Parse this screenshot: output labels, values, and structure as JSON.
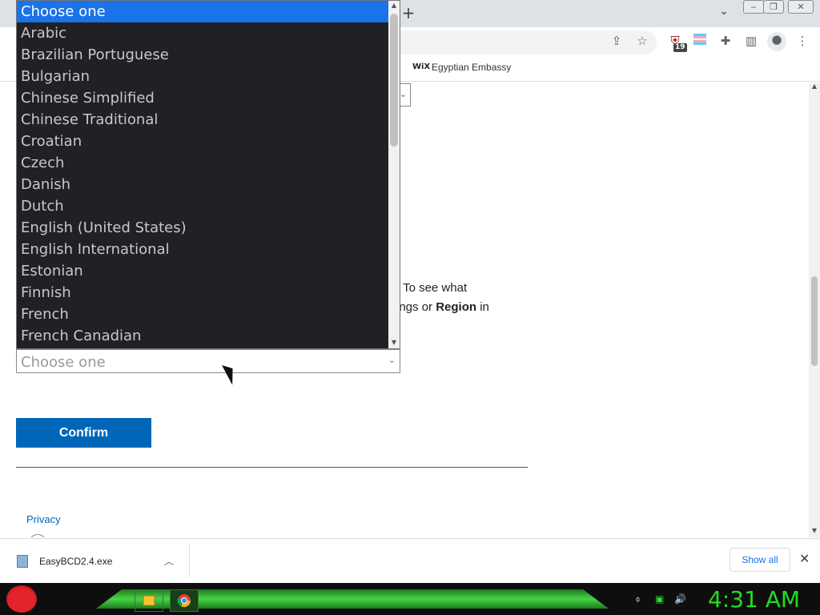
{
  "browser": {
    "new_tab_glyph": "+",
    "tab_search_glyph": "⌄",
    "window_controls": [
      "‒",
      "❐",
      "✕"
    ],
    "toolbar_icons": [
      "share-icon",
      "bookmark-star-icon",
      "extension-shield-icon",
      "extension-flag-icon",
      "extensions-puzzle-icon",
      "side-panel-icon",
      "profile-icon",
      "menu-icon"
    ],
    "extension_badge": "19",
    "bookmark": {
      "favicon_text": "WiX",
      "label": "Egyptian Embassy"
    }
  },
  "page": {
    "partial_line1": ". To see what",
    "partial_line2_pre": "ings or ",
    "partial_line2_bold": "Region",
    "partial_line2_post": " in",
    "select_placeholder": "Choose one",
    "confirm_label": "Confirm",
    "privacy_link": "Privacy"
  },
  "dropdown": {
    "items": [
      "Choose one",
      "Arabic",
      "Brazilian Portuguese",
      "Bulgarian",
      "Chinese Simplified",
      "Chinese Traditional",
      "Croatian",
      "Czech",
      "Danish",
      "Dutch",
      "English (United States)",
      "English International",
      "Estonian",
      "Finnish",
      "French",
      "French Canadian"
    ],
    "selected_index": 0,
    "colors": {
      "background": "#202124",
      "highlight": "#1a73e8",
      "text": "#c8c8c8"
    }
  },
  "downloads": {
    "file_name": "EasyBCD2.4.exe",
    "show_all": "Show all"
  },
  "taskbar": {
    "clock": "4:31 AM",
    "accent": "#22dd22"
  }
}
